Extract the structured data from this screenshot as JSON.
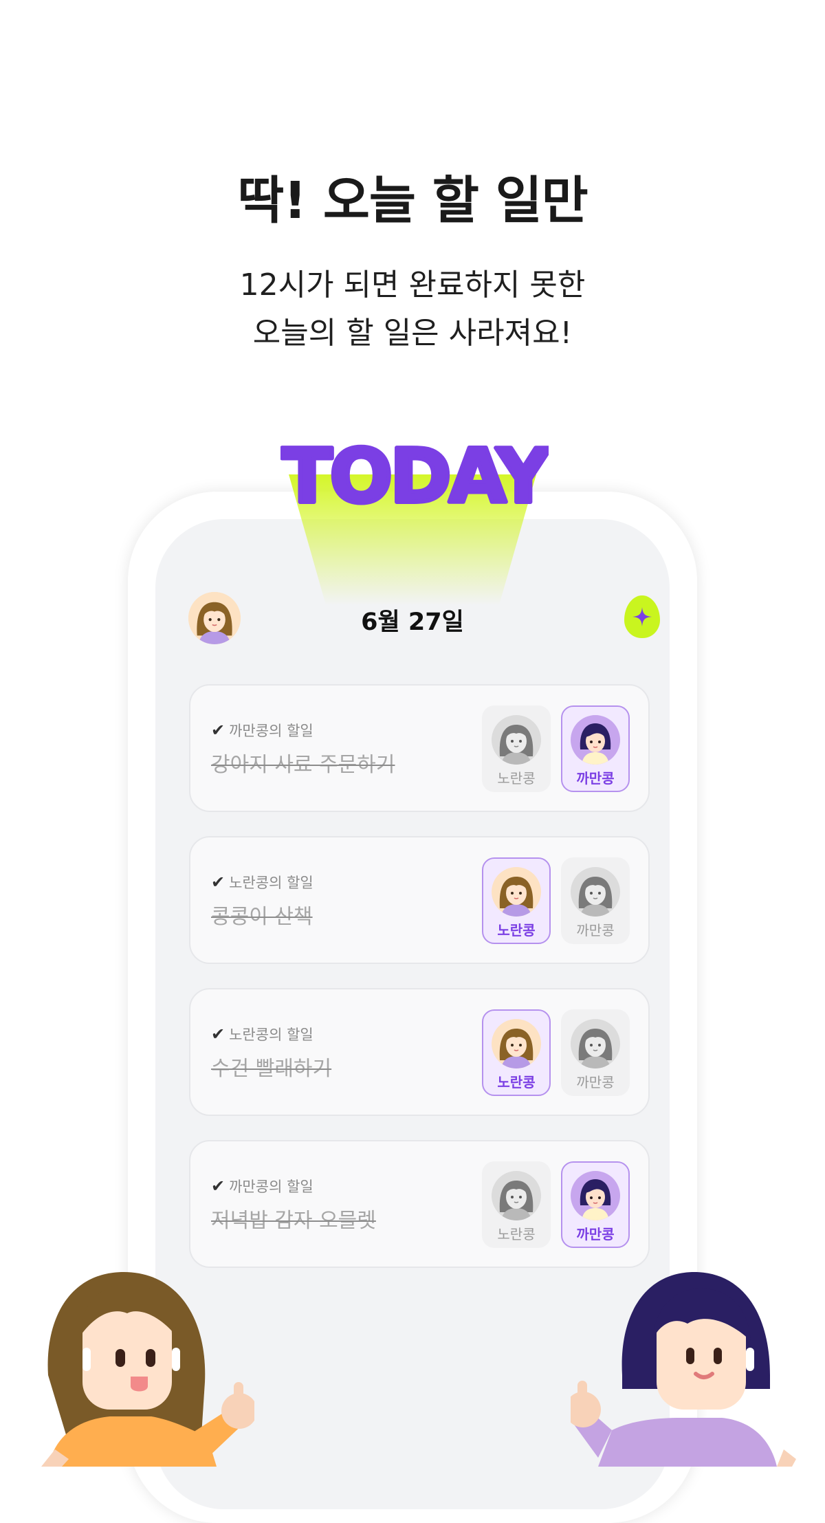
{
  "headline": "딱! 오늘 할 일만",
  "subline": [
    "12시가 되면 완료하지 못한",
    "오늘의 할 일은 사라져요!"
  ],
  "banner": "TODAY",
  "date": "6월 27일",
  "colors": {
    "purple": "#7b3fe4",
    "lime": "#c9f51f"
  },
  "icons": {
    "check": "✔",
    "sparkle": "sparkle-icon"
  },
  "tasks": [
    {
      "owner": "까만콩의 할일",
      "title": "강아지 사료 주문하기",
      "assignees": [
        {
          "name": "노란콩",
          "active": false
        },
        {
          "name": "까만콩",
          "active": true
        }
      ]
    },
    {
      "owner": "노란콩의 할일",
      "title": "콩콩이 산책",
      "assignees": [
        {
          "name": "노란콩",
          "active": true
        },
        {
          "name": "까만콩",
          "active": false
        }
      ]
    },
    {
      "owner": "노란콩의 할일",
      "title": "수건 빨래하기",
      "assignees": [
        {
          "name": "노란콩",
          "active": true
        },
        {
          "name": "까만콩",
          "active": false
        }
      ]
    },
    {
      "owner": "까만콩의 할일",
      "title": "저녁밥 감자 오믈렛",
      "assignees": [
        {
          "name": "노란콩",
          "active": false
        },
        {
          "name": "까만콩",
          "active": true
        }
      ]
    }
  ]
}
